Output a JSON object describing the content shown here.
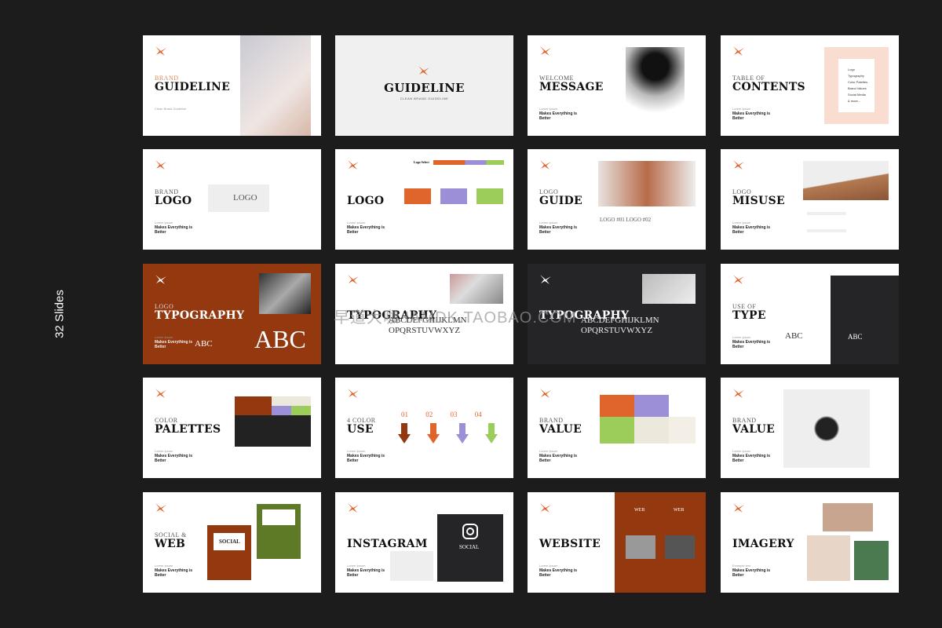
{
  "slide_count_label": "32 Slides",
  "watermark": "早道大咖 IAMDK.TAOBAO.COM",
  "colors": {
    "background": "#1c1c1c",
    "accent": "#e0652b",
    "rust": "#93380f",
    "dark": "#252427",
    "purple": "#9c8fd8",
    "green": "#9ccc5a",
    "peach": "#f8ddd0"
  },
  "slides": [
    {
      "theme": "light",
      "small": "BRAND",
      "small_accent": true,
      "title": "GUIDELINE",
      "tag": "Clean Brand Guideline",
      "sub": "",
      "visual": "photo-hands"
    },
    {
      "theme": "grey",
      "layout": "center",
      "title": "GUIDELINE",
      "small": "Clean Brand Guideline",
      "visual": "none"
    },
    {
      "theme": "light",
      "small": "WELCOME",
      "title": "MESSAGE",
      "tag": "Lorem Ipsum",
      "sub": "Makes Everything is Better",
      "visual": "photo-man"
    },
    {
      "theme": "light",
      "small": "TABLE OF",
      "title": "CONTENTS",
      "tag": "Lorem Ipsum",
      "sub": "Makes Everything is Better",
      "visual": "toc",
      "toc": [
        "Logo",
        "Typography",
        "Color Palettes",
        "Brand Values",
        "Social Media",
        "& more..."
      ]
    },
    {
      "theme": "light",
      "small": "BRAND",
      "title": "LOGO",
      "tag": "Lorem Ipsum",
      "sub": "Makes Everything is Better",
      "visual": "logo-box",
      "extra": "LOGO"
    },
    {
      "theme": "light",
      "small": "",
      "title": "LOGO",
      "tag": "Lorem Ipsum",
      "sub": "Makes Everything is Better",
      "visual": "logo-colors",
      "extra": "Logo Select"
    },
    {
      "theme": "light",
      "small": "LOGO",
      "title": "GUIDE",
      "tag": "Lorem Ipsum",
      "sub": "Makes Everything is Better",
      "visual": "photo-plant",
      "extra": "LOGO #01  LOGO #02"
    },
    {
      "theme": "light",
      "small": "LOGO",
      "title": "MISUSE",
      "tag": "Lorem Ipsum",
      "sub": "Makes Everything is Better",
      "visual": "photo-dune"
    },
    {
      "theme": "rust",
      "small": "LOGO",
      "title": "TYPOGRAPHY",
      "tag": "Lorem Ipsum",
      "sub": "Makes Everything is Better",
      "visual": "abc-rust",
      "extra": "ABC"
    },
    {
      "theme": "light",
      "small": "",
      "title": "TYPOGRAPHY",
      "tag": "",
      "sub": "",
      "visual": "alphabet",
      "extra": "ABCDEFGHIJKLMN OPQRSTUVWXYZ"
    },
    {
      "theme": "dark",
      "small": "",
      "title": "TYPOGRAPHY",
      "tag": "",
      "sub": "",
      "visual": "alphabet-dark",
      "extra": "ABCDEFGHIJKLMN OPQRSTUVWXYZ"
    },
    {
      "theme": "light",
      "small": "USE OF",
      "title": "TYPE",
      "tag": "Lorem Ipsum",
      "sub": "Makes Everything is Better",
      "visual": "type-cols",
      "extra": "ABC"
    },
    {
      "theme": "light",
      "small": "COLOR",
      "title": "PALETTES",
      "tag": "Lorem Ipsum",
      "sub": "Makes Everything is Better",
      "visual": "palette"
    },
    {
      "theme": "light",
      "small": "4 COLOR",
      "title": "USE",
      "tag": "Lorem Ipsum",
      "sub": "Makes Everything is Better",
      "visual": "arrows",
      "extra": "01  02  03  04"
    },
    {
      "theme": "light",
      "small": "BRAND",
      "title": "VALUE",
      "tag": "Lorem Ipsum",
      "sub": "Makes Everything is Better",
      "visual": "value-grid"
    },
    {
      "theme": "light",
      "small": "BRAND",
      "title": "VALUE",
      "tag": "Lorem Ipsum",
      "sub": "Makes Everything is Better",
      "visual": "photo-bag"
    },
    {
      "theme": "light",
      "small": "SOCIAL &",
      "title": "WEB",
      "tag": "Lorem Ipsum",
      "sub": "Makes Everything is Better",
      "visual": "social",
      "extra": "SOCIAL"
    },
    {
      "theme": "light",
      "small": "",
      "title": "INSTAGRAM",
      "tag": "Lorem Ipsum",
      "sub": "Makes Everything is Better",
      "visual": "instagram",
      "extra": "SOCIAL"
    },
    {
      "theme": "light",
      "small": "",
      "title": "WEBSITE",
      "tag": "Lorem Ipsum",
      "sub": "Makes Everything is Better",
      "visual": "website",
      "extra": "WEB"
    },
    {
      "theme": "light",
      "small": "",
      "title": "IMAGERY",
      "tag": "Example text",
      "sub": "Makes Everything is Better",
      "visual": "collage"
    }
  ]
}
